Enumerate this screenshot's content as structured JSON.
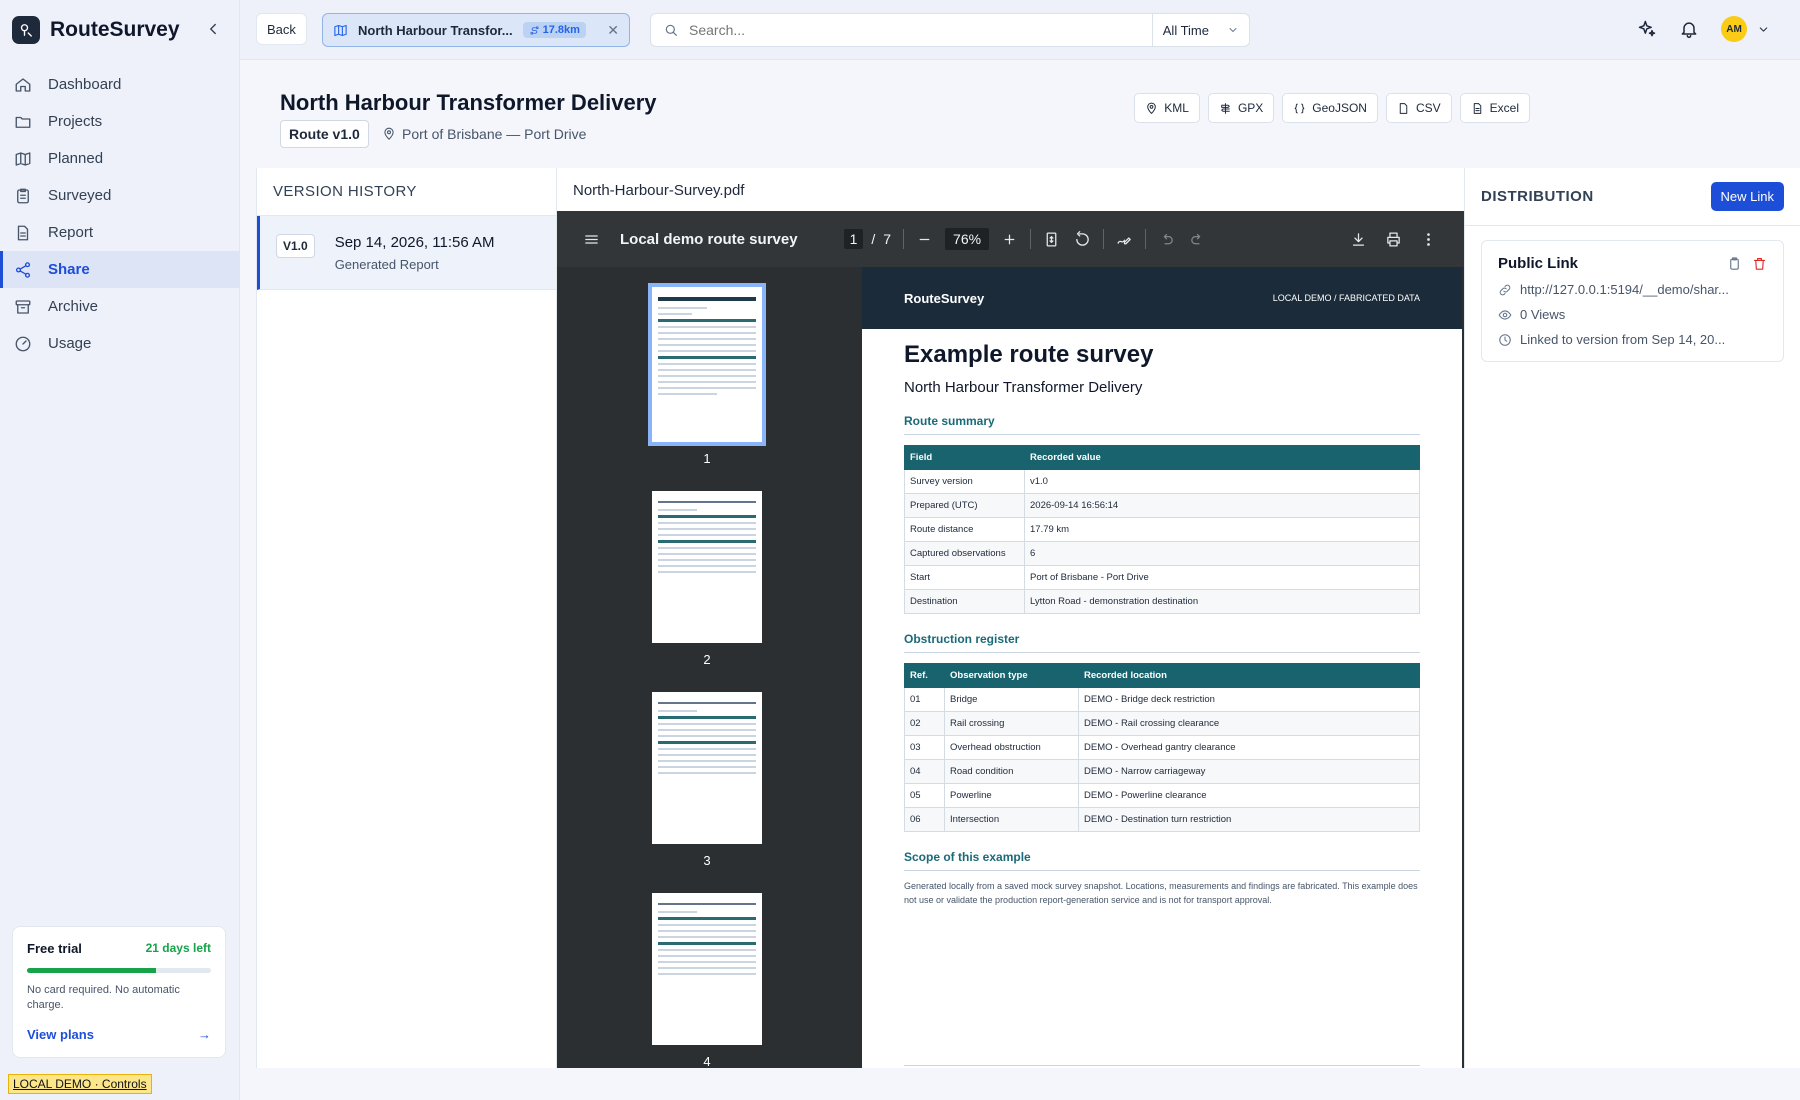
{
  "app": {
    "name": "RouteSurvey"
  },
  "sidebar": {
    "items": [
      {
        "label": "Dashboard",
        "icon": "home-icon"
      },
      {
        "label": "Projects",
        "icon": "folder-icon"
      },
      {
        "label": "Planned",
        "icon": "map-icon"
      },
      {
        "label": "Surveyed",
        "icon": "clipboard-icon"
      },
      {
        "label": "Report",
        "icon": "file-icon"
      },
      {
        "label": "Share",
        "icon": "share-icon",
        "active": true
      },
      {
        "label": "Archive",
        "icon": "archive-icon"
      },
      {
        "label": "Usage",
        "icon": "gauge-icon"
      }
    ],
    "trial": {
      "title": "Free trial",
      "days_left": "21 days left",
      "progress_fraction": 0.7,
      "note": "No card required. No automatic charge.",
      "link": "View plans"
    },
    "demo_tag": "LOCAL DEMO · Controls"
  },
  "topbar": {
    "back": "Back",
    "route_tab": {
      "title": "North Harbour Transfor...",
      "distance": "17.8km"
    },
    "search_placeholder": "Search...",
    "range": "All Time",
    "avatar": "AM"
  },
  "header": {
    "title": "North Harbour Transformer Delivery",
    "version": "Route v1.0",
    "location": "Port of Brisbane — Port Drive",
    "exports": [
      "KML",
      "GPX",
      "GeoJSON",
      "CSV",
      "Excel"
    ]
  },
  "version_history": {
    "title": "VERSION HISTORY",
    "items": [
      {
        "badge": "V1.0",
        "date": "Sep 14, 2026, 11:56 AM",
        "sub": "Generated Report"
      }
    ]
  },
  "pdf": {
    "filename": "North-Harbour-Survey.pdf",
    "doc_title": "Local demo route survey",
    "page": "1",
    "pages": "7",
    "zoom": "76%",
    "thumb_labels": [
      "1",
      "2",
      "3",
      "4"
    ],
    "page_content": {
      "brand": "RouteSurvey",
      "tag": "LOCAL DEMO / FABRICATED DATA",
      "title": "Example route survey",
      "subtitle": "North Harbour Transformer Delivery",
      "summary_heading": "Route summary",
      "summary_cols": [
        "Field",
        "Recorded value"
      ],
      "summary_rows": [
        [
          "Survey version",
          "v1.0"
        ],
        [
          "Prepared (UTC)",
          "2026-09-14 16:56:14"
        ],
        [
          "Route distance",
          "17.79 km"
        ],
        [
          "Captured observations",
          "6"
        ],
        [
          "Start",
          "Port of Brisbane - Port Drive"
        ],
        [
          "Destination",
          "Lytton Road - demonstration destination"
        ]
      ],
      "obstruction_heading": "Obstruction register",
      "obstruction_cols": [
        "Ref.",
        "Observation type",
        "Recorded location"
      ],
      "obstruction_rows": [
        [
          "01",
          "Bridge",
          "DEMO - Bridge deck restriction"
        ],
        [
          "02",
          "Rail crossing",
          "DEMO - Rail crossing clearance"
        ],
        [
          "03",
          "Overhead obstruction",
          "DEMO - Overhead gantry clearance"
        ],
        [
          "04",
          "Road condition",
          "DEMO - Narrow carriageway"
        ],
        [
          "05",
          "Powerline",
          "DEMO - Powerline clearance"
        ],
        [
          "06",
          "Intersection",
          "DEMO - Destination turn restriction"
        ]
      ],
      "scope_heading": "Scope of this example",
      "scope_text": "Generated locally from a saved mock survey snapshot. Locations, measurements and findings are fabricated. This example does not use or validate the production report-generation service and is not for transport approval."
    }
  },
  "distribution": {
    "title": "DISTRIBUTION",
    "new_link": "New Link",
    "card": {
      "title": "Public Link",
      "url": "http://127.0.0.1:5194/__demo/shar...",
      "views": "0 Views",
      "linked": "Linked to version from Sep 14, 20..."
    }
  },
  "colors": {
    "accent": "#1d4ed8",
    "success": "#16a34a",
    "teal_header": "#18636d",
    "pdf_toolbar": "#323639"
  }
}
